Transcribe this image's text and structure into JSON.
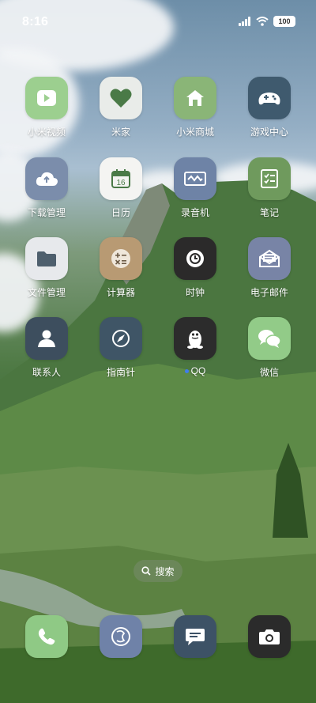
{
  "status_bar": {
    "time": "8:16",
    "battery": "100"
  },
  "apps": [
    {
      "label": "小米视频",
      "icon": "play-icon",
      "color": "#9ccf8f"
    },
    {
      "label": "米家",
      "icon": "heart-icon",
      "color": "#e9ece9"
    },
    {
      "label": "小米商城",
      "icon": "house-icon",
      "color": "#8ab577"
    },
    {
      "label": "游戏中心",
      "icon": "gamepad-icon",
      "color": "#3f5a6e"
    },
    {
      "label": "下载管理",
      "icon": "cloud-upload-icon",
      "color": "#7b8dab"
    },
    {
      "label": "日历",
      "icon": "calendar-icon",
      "color": "#f4f4f2",
      "day": "16"
    },
    {
      "label": "录音机",
      "icon": "waveform-icon",
      "color": "#6e83a6"
    },
    {
      "label": "笔记",
      "icon": "checklist-icon",
      "color": "#6f9a5d"
    },
    {
      "label": "文件管理",
      "icon": "folder-icon",
      "color": "#e7e9ec"
    },
    {
      "label": "计算器",
      "icon": "calculator-icon",
      "color": "#b89a73"
    },
    {
      "label": "时钟",
      "icon": "clock-icon",
      "color": "#2b2a2a"
    },
    {
      "label": "电子邮件",
      "icon": "mail-icon",
      "color": "#7884a6"
    },
    {
      "label": "联系人",
      "icon": "person-icon",
      "color": "#3d4e5e"
    },
    {
      "label": "指南针",
      "icon": "compass-icon",
      "color": "#3f5566"
    },
    {
      "label": "QQ",
      "icon": "penguin-icon",
      "color": "#2c2c2c"
    },
    {
      "label": "微信",
      "icon": "chat-bubbles-icon",
      "color": "#92cb88"
    }
  ],
  "search": {
    "label": "搜索"
  },
  "dock": [
    {
      "icon": "phone-icon",
      "color": "#8fc985"
    },
    {
      "icon": "browser-icon",
      "color": "#6f82a8"
    },
    {
      "icon": "message-icon",
      "color": "#3d5266"
    },
    {
      "icon": "camera-icon",
      "color": "#2b2b2b"
    }
  ]
}
